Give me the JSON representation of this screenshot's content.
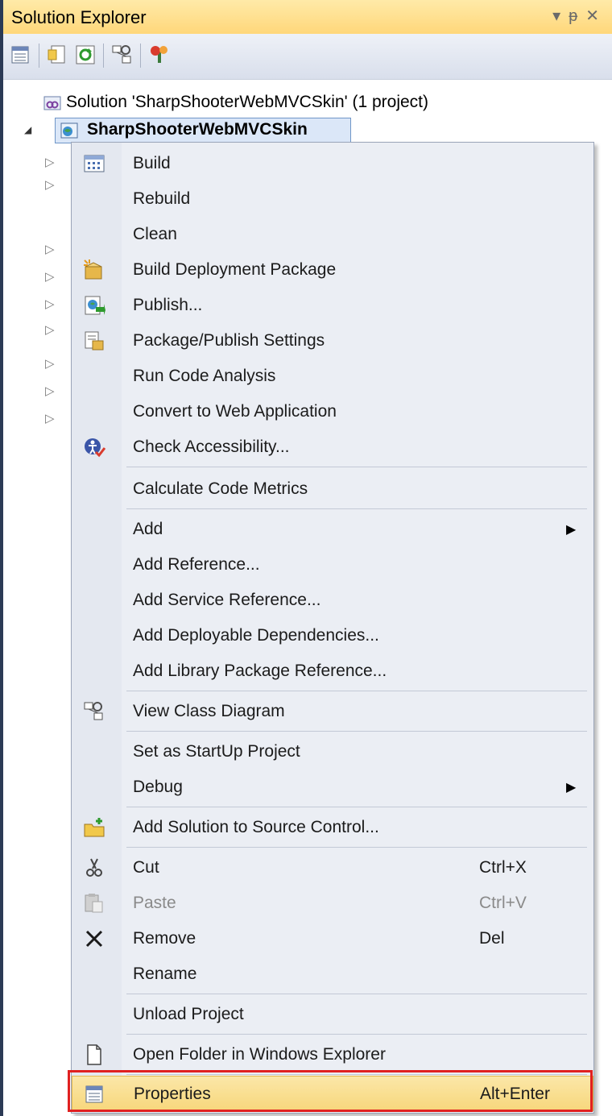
{
  "panel": {
    "title": "Solution Explorer",
    "controls": [
      "▾",
      "ᵽ",
      "✕"
    ]
  },
  "toolbar": {
    "buttons": [
      "properties-icon",
      "show-all-files-icon",
      "refresh-icon",
      "class-diagram-icon",
      "nuget-icon"
    ]
  },
  "tree": {
    "solution_label": "Solution 'SharpShooterWebMVCSkin' (1 project)",
    "project_label": "SharpShooterWebMVCSkin",
    "expander_collapsed": "▷",
    "expander_expanded": "◢"
  },
  "menu": {
    "items": [
      {
        "label": "Build",
        "icon": "build-icon"
      },
      {
        "label": "Rebuild"
      },
      {
        "label": "Clean"
      },
      {
        "label": "Build Deployment Package",
        "icon": "package-icon"
      },
      {
        "label": "Publish...",
        "icon": "publish-icon"
      },
      {
        "label": "Package/Publish Settings",
        "icon": "settings-icon"
      },
      {
        "label": "Run Code Analysis"
      },
      {
        "label": "Convert to Web Application"
      },
      {
        "label": "Check Accessibility...",
        "icon": "accessibility-icon"
      },
      {
        "label": "Calculate Code Metrics"
      },
      {
        "label": "Add",
        "submenu": true
      },
      {
        "label": "Add Reference..."
      },
      {
        "label": "Add Service Reference..."
      },
      {
        "label": "Add Deployable Dependencies..."
      },
      {
        "label": "Add Library Package Reference..."
      },
      {
        "label": "View Class Diagram",
        "icon": "class-diagram-icon"
      },
      {
        "label": "Set as StartUp Project"
      },
      {
        "label": "Debug",
        "submenu": true
      },
      {
        "label": "Add Solution to Source Control...",
        "icon": "source-control-icon"
      },
      {
        "label": "Cut",
        "shortcut": "Ctrl+X",
        "icon": "cut-icon"
      },
      {
        "label": "Paste",
        "shortcut": "Ctrl+V",
        "icon": "paste-icon",
        "disabled": true
      },
      {
        "label": "Remove",
        "shortcut": "Del",
        "icon": "remove-icon"
      },
      {
        "label": "Rename"
      },
      {
        "label": "Unload Project"
      },
      {
        "label": "Open Folder in Windows Explorer",
        "icon": "open-folder-icon"
      },
      {
        "label": "Properties",
        "shortcut": "Alt+Enter",
        "icon": "properties-icon",
        "highlighted": true
      }
    ],
    "submenu_arrow": "▶"
  },
  "colors": {
    "titlebar": "#ffd77a",
    "menu_background": "#ebeef4",
    "highlight_border": "#e02020"
  }
}
